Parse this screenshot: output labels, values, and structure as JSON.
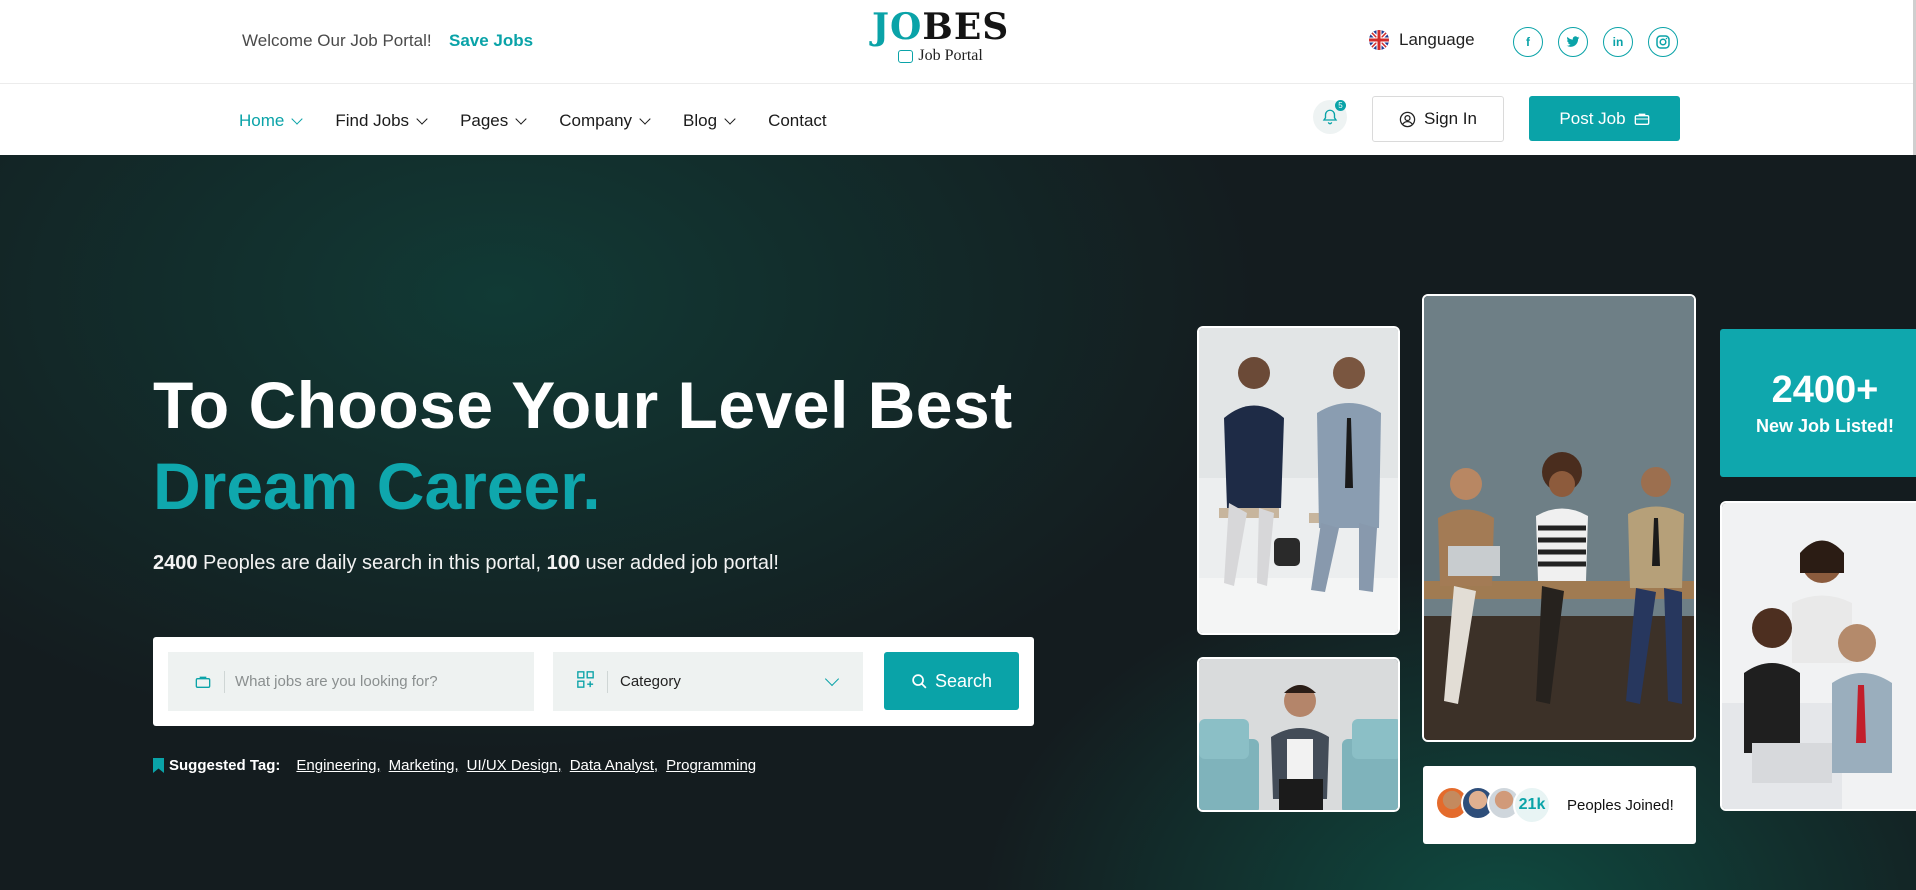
{
  "topbar": {
    "welcome": "Welcome Our Job Portal!",
    "save_jobs": "Save Jobs",
    "logo_part_accent": "JO",
    "logo_part_dark": "BES",
    "logo_sub": "Job Portal",
    "language": "Language",
    "socials": [
      {
        "icon": "facebook-icon",
        "glyph": "f"
      },
      {
        "icon": "twitter-icon",
        "glyph": "t"
      },
      {
        "icon": "linkedin-icon",
        "glyph": "in"
      },
      {
        "icon": "instagram-icon",
        "glyph": "◎"
      }
    ]
  },
  "nav": {
    "items": [
      {
        "label": "Home",
        "active": true,
        "dropdown": true
      },
      {
        "label": "Find Jobs",
        "dropdown": true
      },
      {
        "label": "Pages",
        "dropdown": true
      },
      {
        "label": "Company",
        "dropdown": true
      },
      {
        "label": "Blog",
        "dropdown": true
      },
      {
        "label": "Contact",
        "dropdown": false
      }
    ],
    "notification_count": "5",
    "sign_in": "Sign In",
    "post_job": "Post Job"
  },
  "hero": {
    "title_line1": "To Choose Your Level Best",
    "title_line2": "Dream Career.",
    "sub_num1": "2400",
    "sub_text1": " Peoples are daily search in this portal, ",
    "sub_num2": "100",
    "sub_text2": " user added job portal!"
  },
  "search": {
    "jobs_placeholder": "What jobs are you looking for?",
    "category": "Category",
    "button": "Search"
  },
  "tags": {
    "label": "Suggested Tag:",
    "items": [
      "Engineering,",
      "Marketing,",
      "UI/UX Design,",
      "Data Analyst,",
      "Programming"
    ]
  },
  "stats": {
    "number": "2400+",
    "label": "New Job Listed!",
    "joined_count": "21k",
    "joined_label": "Peoples Joined!"
  },
  "colors": {
    "accent": "#0aa3a8",
    "hero_bg": "#141c1f"
  }
}
